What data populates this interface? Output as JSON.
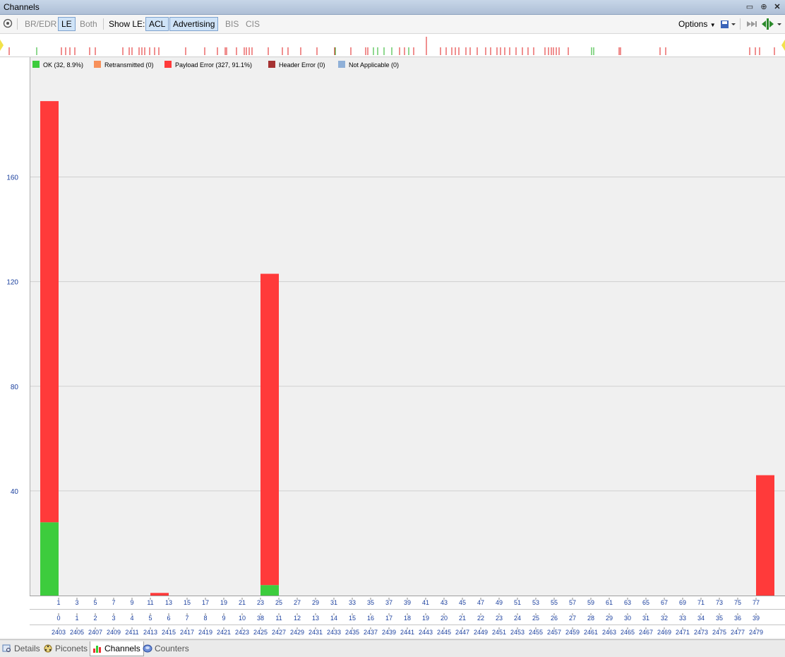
{
  "window": {
    "title": "Channels"
  },
  "toolbar": {
    "br_edr": "BR/EDR",
    "le": "LE",
    "both": "Both",
    "show_le_label": "Show LE:",
    "acl": "ACL",
    "advertising": "Advertising",
    "bis": "BIS",
    "cis": "CIS",
    "options": "Options"
  },
  "legend": [
    {
      "label": "OK (32, 8.9%)",
      "color": "#3dcc3d"
    },
    {
      "label": "Retransmitted (0)",
      "color": "#f7905a"
    },
    {
      "label": "Payload Error (327, 91.1%)",
      "color": "#ff3a3a"
    },
    {
      "label": "Header Error (0)",
      "color": "#a63232"
    },
    {
      "label": "Not Applicable (0)",
      "color": "#8fb0d8"
    }
  ],
  "colors": {
    "ok": "#3dcc3d",
    "payload_error": "#ff3a3a",
    "axis_text": "#1a3f9e"
  },
  "chart_data": {
    "type": "bar",
    "stacked": true,
    "ylim": [
      0,
      190
    ],
    "yticks": [
      40,
      80,
      120,
      160
    ],
    "grid": true,
    "legend_position": "top-left",
    "x_row1": [
      1,
      3,
      5,
      7,
      9,
      11,
      13,
      15,
      17,
      19,
      21,
      23,
      25,
      27,
      29,
      31,
      33,
      35,
      37,
      39,
      41,
      43,
      45,
      47,
      49,
      51,
      53,
      55,
      57,
      59,
      61,
      63,
      65,
      67,
      69,
      71,
      73,
      75,
      77
    ],
    "x_row2": [
      0,
      1,
      2,
      3,
      4,
      5,
      6,
      7,
      8,
      9,
      10,
      38,
      11,
      12,
      13,
      14,
      15,
      16,
      17,
      18,
      19,
      20,
      21,
      22,
      23,
      24,
      25,
      26,
      27,
      28,
      29,
      30,
      31,
      32,
      33,
      34,
      35,
      36,
      39
    ],
    "x_row3": [
      2403,
      2405,
      2407,
      2409,
      2411,
      2413,
      2415,
      2417,
      2419,
      2421,
      2423,
      2425,
      2427,
      2429,
      2431,
      2433,
      2435,
      2437,
      2439,
      2441,
      2443,
      2445,
      2447,
      2449,
      2451,
      2453,
      2455,
      2457,
      2459,
      2461,
      2463,
      2465,
      2467,
      2469,
      2471,
      2473,
      2475,
      2477,
      2479
    ],
    "series": [
      {
        "name": "OK",
        "points": [
          {
            "channel": 2402,
            "value": 28
          },
          {
            "channel": 2426,
            "value": 4
          }
        ]
      },
      {
        "name": "Payload Error",
        "points": [
          {
            "channel": 2402,
            "value": 161
          },
          {
            "channel": 2414,
            "value": 1
          },
          {
            "channel": 2426,
            "value": 119
          },
          {
            "channel": 2480,
            "value": 46
          }
        ]
      }
    ]
  },
  "timeline": {
    "red_marks": [
      13,
      87,
      93,
      99,
      106,
      127,
      135,
      174,
      183,
      187,
      197,
      201,
      205,
      212,
      219,
      225,
      263,
      290,
      308,
      319,
      321,
      335,
      346,
      349,
      353,
      357,
      380,
      400,
      408,
      426,
      449,
      474,
      497,
      518,
      521,
      566,
      573,
      586,
      604,
      624,
      632,
      640,
      645,
      650,
      660,
      666,
      676,
      688,
      695,
      704,
      709,
      715,
      722,
      731,
      740,
      748,
      756,
      772,
      777,
      781,
      784,
      788,
      792,
      805,
      877,
      879,
      935,
      943,
      1062,
      1070,
      1076,
      1097
    ],
    "green_marks": [
      52,
      475,
      529,
      535,
      544,
      555,
      579,
      838,
      841
    ],
    "tall_mark": 604
  },
  "bottom_tabs": [
    {
      "label": "Details",
      "icon": "magnifier-icon"
    },
    {
      "label": "Piconets",
      "icon": "network-icon"
    },
    {
      "label": "Channels",
      "icon": "bar-chart-icon"
    },
    {
      "label": "Counters",
      "icon": "counter-disk-icon"
    }
  ]
}
